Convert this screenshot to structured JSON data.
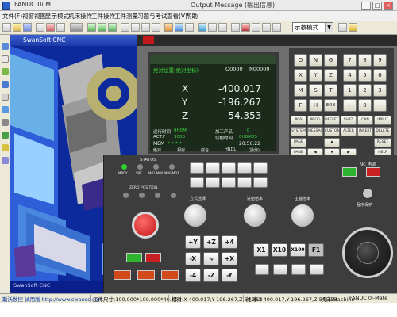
{
  "titlebar": {
    "app_title": "FANUC 0i M",
    "second_title": "Output Message (输出信息)"
  },
  "menubar": {
    "items": [
      "文件(F)",
      "视窗视图",
      "显示模式",
      "机床操作",
      "工件操作",
      "工件测量",
      "习题与考试",
      "查看(V)",
      "帮助"
    ]
  },
  "toolbar": {
    "mode_value": "示教模式"
  },
  "view3d": {
    "header": "SwanSoft CNC",
    "footer": "SwanSoft CNC"
  },
  "lcd": {
    "title": "绝对位置(绝对坐标)",
    "program": "O0000",
    "sequence": "N00000",
    "axes": [
      {
        "axis": "X",
        "value": "-400.017"
      },
      {
        "axis": "Y",
        "value": "-196.267"
      },
      {
        "axis": "Z",
        "value": "-54.353"
      }
    ],
    "run_time_label": "运行时间",
    "run_time_value": "0H0M",
    "parts_label": "加工产品",
    "parts_value": "0",
    "cycle_label": "切削时间",
    "cycle_value": "0H0M0S",
    "act_f_label": "ACT.F",
    "act_f_value": "3000",
    "mem_label": "MEM",
    "mem_stars": "* * * *",
    "time_value": "20:56:22",
    "soft_keys": [
      "绝对",
      "相对",
      "综合",
      "HNDL",
      "(操作)"
    ]
  },
  "keypad": {
    "rows": [
      [
        "O",
        "N",
        "G",
        "7",
        "8",
        "9"
      ],
      [
        "X",
        "Y",
        "Z",
        "4",
        "5",
        "6"
      ],
      [
        "M",
        "S",
        "T",
        "1",
        "2",
        "3"
      ],
      [
        "F",
        "H",
        "EOB",
        "-",
        "0",
        "."
      ]
    ],
    "fn_row1": [
      "POS",
      "PROG",
      "OFFSET SETTING",
      "SHIFT",
      "CAN",
      "INPUT"
    ],
    "fn_row2": [
      "SYSTEM",
      "MESSAGE",
      "CUSTOM GRAPH",
      "ALTER",
      "INSERT",
      "DELETE"
    ],
    "fn_row3": [
      "PAGE",
      "",
      "",
      "",
      "",
      "RESET"
    ],
    "fn_row4": [
      "PAGE",
      "",
      "",
      "",
      "",
      "HELP"
    ]
  },
  "panel": {
    "status_title": "STATUS",
    "status_leds": [
      "MRDY",
      "SBK",
      "M01 M00",
      "M00/M03"
    ],
    "zero_label": "ZERO POSITION",
    "zero_axes": [
      "X",
      "Y",
      "Z",
      "4"
    ],
    "mode_label": "方式选择",
    "feed_label": "进给倍率",
    "spindle_label": "主轴倍率",
    "top_buttons": [
      "单步",
      "选择停止",
      "跳过",
      "空运行",
      "手动示教",
      "机械锁住",
      "工具台",
      "Z轴锁住",
      "主轴正转",
      "主轴反转"
    ],
    "jog_buttons": [
      "+Y",
      "+Z",
      "+4",
      "-X",
      "∿",
      "+X",
      "-4",
      "-Z",
      "-Y"
    ],
    "rate_buttons": [
      "X1",
      "X10",
      "X100",
      "F1"
    ],
    "nc_label": "NC 电源",
    "program_protect": "程序保护",
    "cycle_buttons": [
      "循环启动",
      "进给保持",
      "M00停止"
    ]
  },
  "status": {
    "company": "斯沃数控 试用版 http://www.swansc.com",
    "workpiece": "工件尺寸:100.000*100.000*40.000",
    "relative": "相对:X-400.017,Y-196.267,Z-54.353",
    "absolute": "绝对:X-400.017,Y-196.267,Z-54.353",
    "machine": "机床:Machine",
    "control": "FANUC 0i-Mate"
  },
  "colors": {
    "panel": "#3d3d3d",
    "lcd_bg": "#1b2a1b",
    "lcd_text": "#e8f0e8",
    "lcd_green": "#3fd63f",
    "estop": "#d01a1a",
    "view_bg": "#0a1f8a"
  }
}
